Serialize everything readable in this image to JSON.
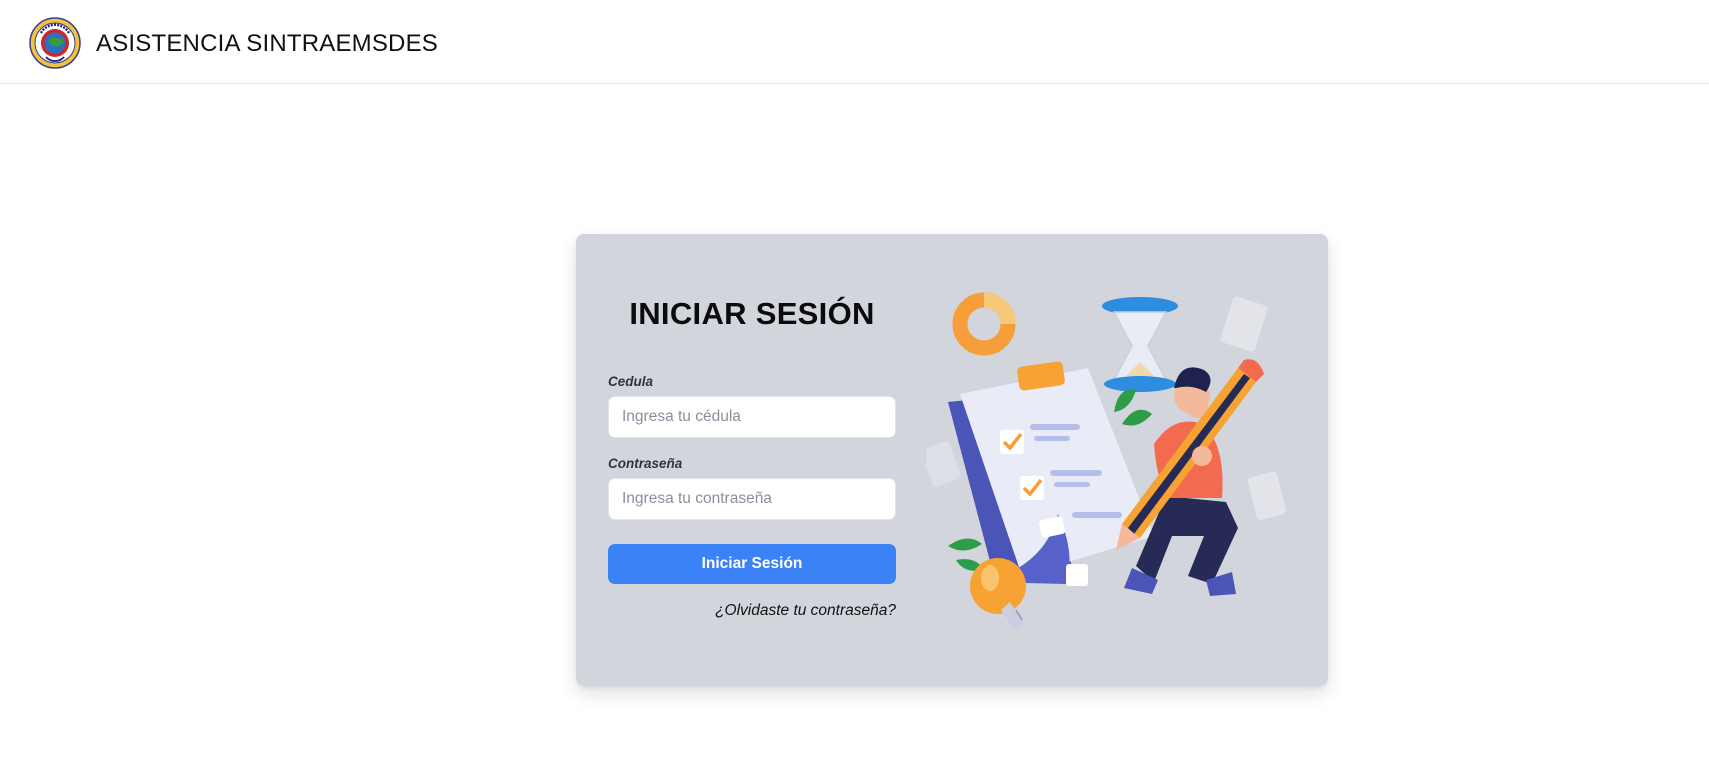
{
  "header": {
    "app_title": "ASISTENCIA SINTRAEMSDES",
    "logo_icon": "sintraemsdes-logo-icon"
  },
  "login": {
    "heading": "INICIAR SESIÓN",
    "cedula_label": "Cedula",
    "cedula_placeholder": "Ingresa tu cédula",
    "cedula_value": "",
    "password_label": "Contraseña",
    "password_placeholder": "Ingresa tu contraseña",
    "password_value": "",
    "submit_label": "Iniciar Sesión",
    "forgot_label": "¿Olvidaste tu contraseña?",
    "illustration_icon": "checklist-person-illustration"
  },
  "colors": {
    "page_background": "#ffffff",
    "card_background": "#d2d5dc",
    "primary_button": "#3b82f6",
    "illustration_purple": "#5661c9",
    "illustration_orange": "#f7a334",
    "illustration_coral": "#f26b4f"
  }
}
